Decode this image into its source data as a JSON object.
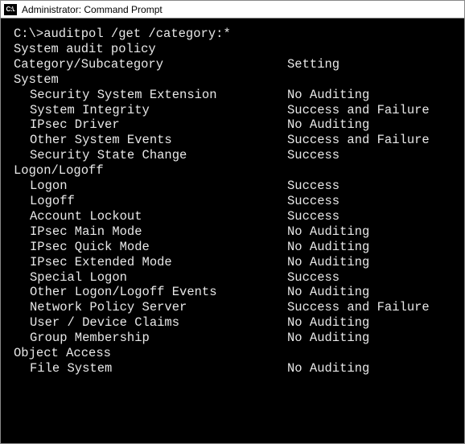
{
  "window": {
    "icon_text": "C:\\.",
    "title": "Administrator: Command Prompt"
  },
  "terminal": {
    "blank": "",
    "prompt": "C:\\>auditpol /get /category:*",
    "policy_line": "System audit policy",
    "header_left": "Category/Subcategory",
    "header_right": "Setting",
    "categories": [
      {
        "name": "System",
        "subs": [
          {
            "name": "Security System Extension",
            "setting": "No Auditing"
          },
          {
            "name": "System Integrity",
            "setting": "Success and Failure"
          },
          {
            "name": "IPsec Driver",
            "setting": "No Auditing"
          },
          {
            "name": "Other System Events",
            "setting": "Success and Failure"
          },
          {
            "name": "Security State Change",
            "setting": "Success"
          }
        ]
      },
      {
        "name": "Logon/Logoff",
        "subs": [
          {
            "name": "Logon",
            "setting": "Success"
          },
          {
            "name": "Logoff",
            "setting": "Success"
          },
          {
            "name": "Account Lockout",
            "setting": "Success"
          },
          {
            "name": "IPsec Main Mode",
            "setting": "No Auditing"
          },
          {
            "name": "IPsec Quick Mode",
            "setting": "No Auditing"
          },
          {
            "name": "IPsec Extended Mode",
            "setting": "No Auditing"
          },
          {
            "name": "Special Logon",
            "setting": "Success"
          },
          {
            "name": "Other Logon/Logoff Events",
            "setting": "No Auditing"
          },
          {
            "name": "Network Policy Server",
            "setting": "Success and Failure"
          },
          {
            "name": "User / Device Claims",
            "setting": "No Auditing"
          },
          {
            "name": "Group Membership",
            "setting": "No Auditing"
          }
        ]
      },
      {
        "name": "Object Access",
        "subs": [
          {
            "name": "File System",
            "setting": "No Auditing"
          }
        ]
      }
    ]
  }
}
